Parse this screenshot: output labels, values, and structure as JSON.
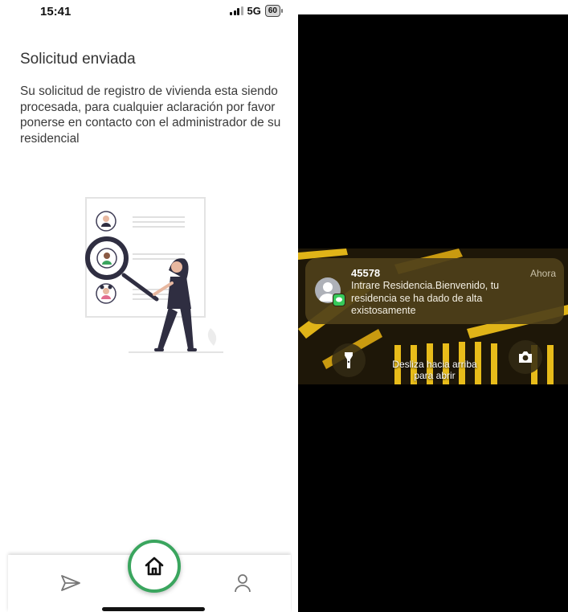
{
  "status_bar": {
    "time": "15:41",
    "network": "5G",
    "battery": "60"
  },
  "page": {
    "title": "Solicitud enviada",
    "message": "Su solicitud de registro de vivienda esta siendo procesada, para cualquier aclaración por favor ponerse en contacto con el administrador de su residencial"
  },
  "bottom_nav": {
    "items": [
      {
        "icon": "send-icon",
        "active": false
      },
      {
        "icon": "home-icon",
        "active": true
      },
      {
        "icon": "user-icon",
        "active": false
      }
    ]
  },
  "lock_screen": {
    "notification": {
      "sender": "45578",
      "time": "Ahora",
      "body": "Intrare Residencia.Bienvenido, tu residencia se ha dado de alta existosamente",
      "app_icon": "messages-icon"
    },
    "swipe_hint": "Desliza hacia arriba para abrir",
    "left_button_icon": "flashlight-icon",
    "right_button_icon": "camera-icon"
  },
  "colors": {
    "accent": "#3aa55e",
    "illustration_dark": "#2f2e41",
    "notification_bg": "#4e401a"
  }
}
